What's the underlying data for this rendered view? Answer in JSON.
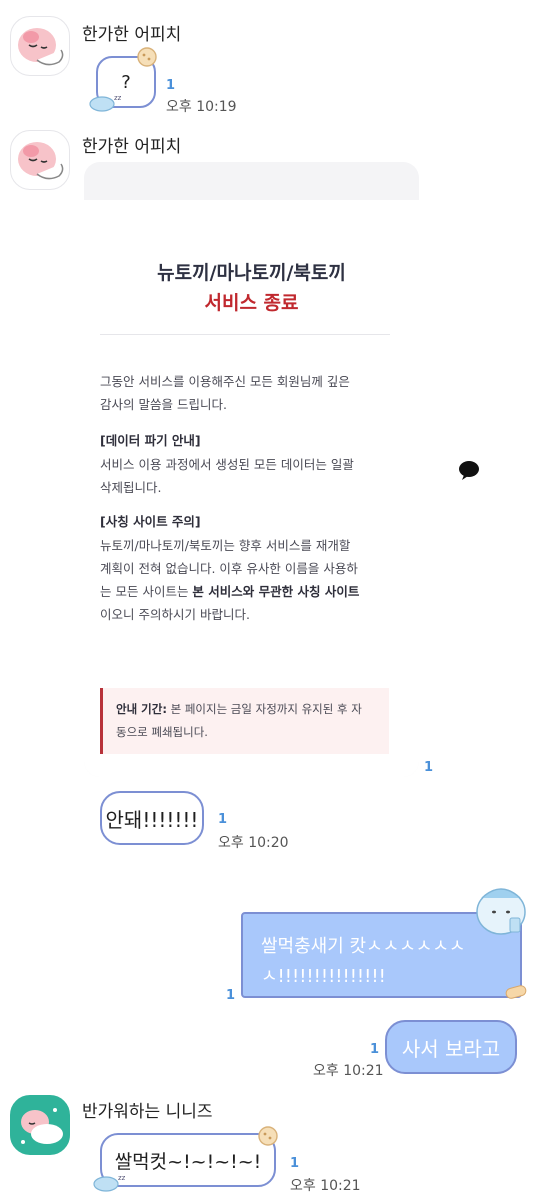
{
  "messages": [
    {
      "sender": "한가한 어피치",
      "text": "?",
      "unread": "1",
      "time": "오후 10:19"
    },
    {
      "sender": "한가한 어피치",
      "unread": "1"
    },
    {
      "text": "안돼!!!!!!!",
      "unread": "1",
      "time": "오후 10:20"
    },
    {
      "text": "쌀먹충새기 캇ㅅㅅㅅㅅㅅㅅㅅ!!!!!!!!!!!!!!!",
      "line1": "쌀먹충새기 캇ㅅㅅㅅㅅㅅㅅ",
      "line2": "ㅅ!!!!!!!!!!!!!!!",
      "unread": "1"
    },
    {
      "text": "사서 보라고",
      "unread": "1",
      "time": "오후 10:21"
    },
    {
      "sender": "반가워하는 니니즈",
      "text": "쌀먹컷~!~!~!~!",
      "unread": "1",
      "time": "오후 10:21"
    }
  ],
  "notice": {
    "title": "뉴토끼/마나토끼/북토끼",
    "subtitle": "서비스 종료",
    "intro_line1": "그동안 서비스를 이용해주신 모든 회원님께 깊은",
    "intro_line2": "감사의 말씀을 드립니다.",
    "data_head": "[데이터 파기 안내]",
    "data_line1": "서비스 이용 과정에서 생성된 모든 데이터는 일괄",
    "data_line2": "삭제됩니다.",
    "fake_head": "[사칭 사이트 주의]",
    "fake_line1": "뉴토끼/마나토끼/북토끼는 향후 서비스를 재개할",
    "fake_line2": "계획이 전혀 없습니다. 이후 유사한 이름을 사용하",
    "fake_line3_pre": "는 모든 사이트는 ",
    "fake_line3_bold": "본 서비스와 무관한 사칭 사이트",
    "fake_line4": "이오니 주의하시기 바랍니다.",
    "box_label": "안내 기간:",
    "box_line1": " 본 페이지는 금일 자정까지 유지된 후 자",
    "box_line2": "동으로 폐쇄됩니다."
  },
  "icons": [
    "apeach-avatar-icon",
    "sleeping-bunny-sticker-icon",
    "cookie-sticker-icon",
    "speech-bubble-icon",
    "bunny-character-sticker-icon",
    "bandage-icon",
    "ninis-avatar-icon"
  ],
  "colors": {
    "bubble_border": "#7c8fd3",
    "bubble_right": "#a9c8fb",
    "unread": "#4a90d9",
    "notice_red": "#c0282e"
  }
}
